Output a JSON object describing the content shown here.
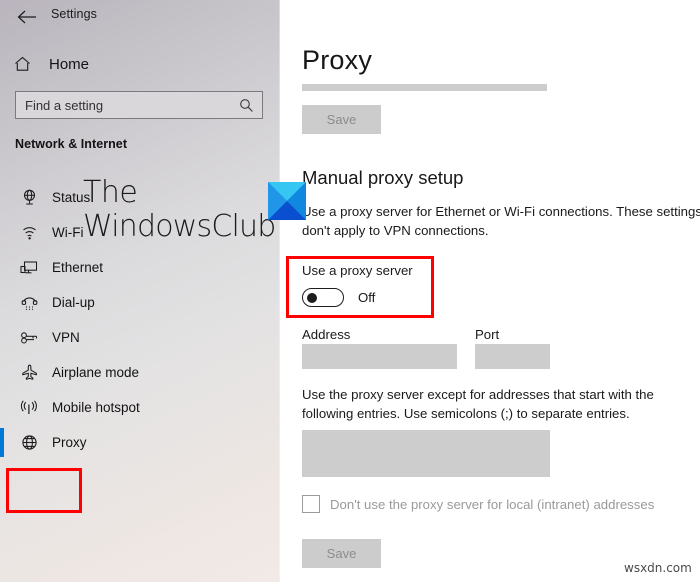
{
  "window": {
    "title": "Settings",
    "back_icon": "back-arrow-icon"
  },
  "sidebar": {
    "home": {
      "label": "Home",
      "icon": "home-icon"
    },
    "search": {
      "placeholder": "Find a setting",
      "value": "",
      "icon": "search-icon"
    },
    "category": "Network & Internet",
    "items": [
      {
        "label": "Status",
        "icon": "globe-status-icon",
        "selected": false
      },
      {
        "label": "Wi-Fi",
        "icon": "wifi-icon",
        "selected": false
      },
      {
        "label": "Ethernet",
        "icon": "ethernet-icon",
        "selected": false
      },
      {
        "label": "Dial-up",
        "icon": "dialup-phone-icon",
        "selected": false
      },
      {
        "label": "VPN",
        "icon": "vpn-key-icon",
        "selected": false
      },
      {
        "label": "Airplane mode",
        "icon": "airplane-icon",
        "selected": false
      },
      {
        "label": "Mobile hotspot",
        "icon": "hotspot-icon",
        "selected": false
      },
      {
        "label": "Proxy",
        "icon": "globe-proxy-icon",
        "selected": true
      }
    ]
  },
  "main": {
    "page_title": "Proxy",
    "save_top_label": "Save",
    "section_heading": "Manual proxy setup",
    "description": "Use a proxy server for Ethernet or Wi-Fi connections. These settings don't apply to VPN connections.",
    "toggle": {
      "label": "Use a proxy server",
      "state": "Off",
      "checked": false
    },
    "address": {
      "label": "Address",
      "value": ""
    },
    "port": {
      "label": "Port",
      "value": ""
    },
    "exceptions_description": "Use the proxy server except for addresses that start with the following entries. Use semicolons (;) to separate entries.",
    "exceptions": {
      "value": ""
    },
    "checkbox": {
      "label": "Don't use the proxy server for local (intranet) addresses",
      "checked": false
    },
    "save_bottom_label": "Save"
  },
  "watermark": {
    "line1": "The",
    "line2": "WindowsClub",
    "logo": "windowsclub-logo-icon",
    "site": "wsxdn.com"
  },
  "colors": {
    "accent": "#0078d7",
    "annotation": "#fe0000",
    "top_accent": "#2f7eb0",
    "disabled_fill": "#cdcdcd"
  }
}
